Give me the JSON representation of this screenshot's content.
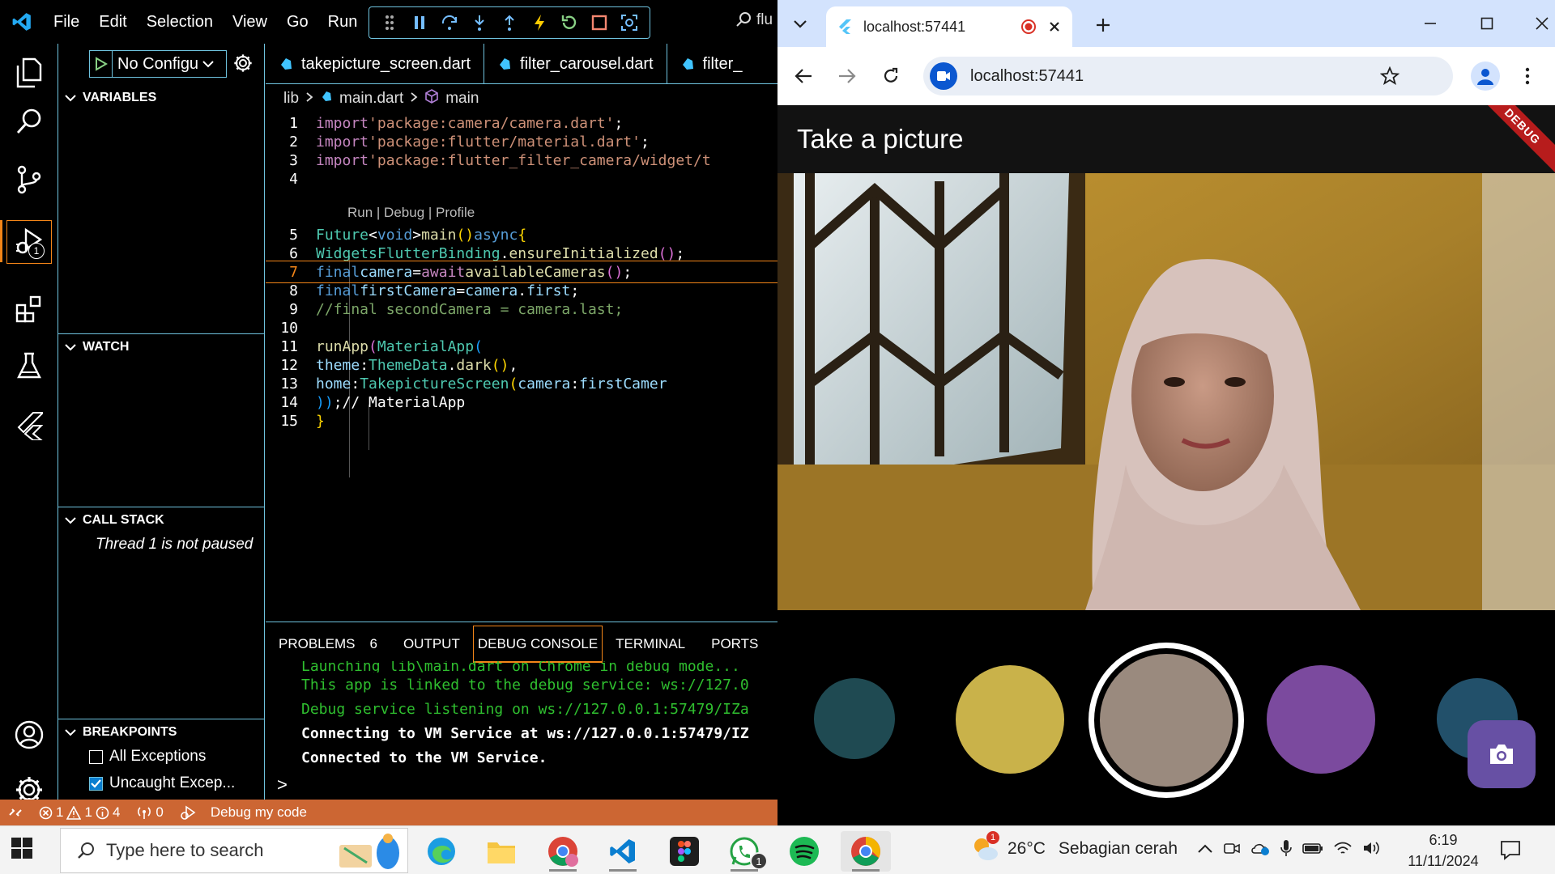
{
  "vscode": {
    "menu": [
      "File",
      "Edit",
      "Selection",
      "View",
      "Go",
      "Run"
    ],
    "title_search": "flu",
    "run_config": "No Configu",
    "sections": {
      "variables": "VARIABLES",
      "watch": "WATCH",
      "call_stack": "CALL STACK",
      "breakpoints": "BREAKPOINTS"
    },
    "thread_status": "Thread 1 is not paused",
    "breakpoints": [
      {
        "label": "All Exceptions",
        "checked": false
      },
      {
        "label": "Uncaught Excep...",
        "checked": true
      }
    ],
    "tabs": [
      "takepicture_screen.dart",
      "filter_carousel.dart",
      "filter_"
    ],
    "breadcrumb": [
      "lib",
      "main.dart",
      "main"
    ],
    "codelens": "Run | Debug | Profile",
    "line_numbers": [
      "1",
      "2",
      "3",
      "4",
      "5",
      "6",
      "7",
      "8",
      "9",
      "10",
      "11",
      "12",
      "13",
      "14",
      "15"
    ],
    "code": {
      "l1_kw": "import",
      "l1_str": "'package:camera/camera.dart'",
      "l1_end": ";",
      "l2_kw": "import",
      "l2_str": "'package:flutter/material.dart'",
      "l2_end": ";",
      "l3_kw": "import",
      "l3_str": "'package:flutter_filter_camera/widget/t",
      "l5_type": "Future",
      "l5_lt": "<",
      "l5_void": "void",
      "l5_gt": ">",
      "l5_fn": "main",
      "l5_paren": "()",
      "l5_async": "async",
      "l5_brace": "{",
      "l6_cls": "WidgetsFlutterBinding",
      "l6_dot": ".",
      "l6_fn": "ensureInitialized",
      "l6_paren": "()",
      "l6_end": ";",
      "l7_kw": "final",
      "l7_var": "camera",
      "l7_eq": "=",
      "l7_await": "await",
      "l7_fn": "availableCameras",
      "l7_paren": "()",
      "l7_end": ";",
      "l8_kw": "final",
      "l8_var": "firstCamera",
      "l8_eq": "=",
      "l8_obj": "camera",
      "l8_dot": ".",
      "l8_prop": "first",
      "l8_end": ";",
      "l9_comment": "//final secondCamera = camera.last;",
      "l11_fn": "runApp",
      "l11_p": "(",
      "l11_cls": "MaterialApp",
      "l11_p2": "(",
      "l12_prop": "theme",
      "l12_colon": ":",
      "l12_cls": "ThemeData",
      "l12_dot": ".",
      "l12_fn": "dark",
      "l12_paren": "()",
      "l12_comma": ",",
      "l13_prop": "home",
      "l13_colon": ":",
      "l13_cls": "TakepictureScreen",
      "l13_p": "(",
      "l13_arg": "camera",
      "l13_colon2": ":",
      "l13_val": "firstCamer",
      "l14_close": "))",
      "l14_end": ";",
      "l14_comment": "// MaterialApp",
      "l15_brace": "}"
    },
    "panel_tabs": [
      {
        "label": "PROBLEMS",
        "count": "6"
      },
      {
        "label": "OUTPUT"
      },
      {
        "label": "DEBUG CONSOLE"
      },
      {
        "label": "TERMINAL"
      },
      {
        "label": "PORTS"
      }
    ],
    "console_lines": [
      "Launching lib\\main.dart on Chrome in debug mode...",
      "This app is linked to the debug service: ws://127.0",
      "Debug service listening on ws://127.0.0.1:57479/IZa",
      "Connecting to VM Service at ws://127.0.0.1:57479/IZ",
      "Connected to the VM Service."
    ],
    "console_prompt": ">",
    "status": {
      "errors": "1",
      "warnings": "1",
      "infos": "4",
      "ports": "0",
      "debug_label": "Debug my code"
    },
    "activity_badge": "1",
    "colors": {
      "accent": "#f38518",
      "border": "#6fc3df",
      "statusbar": "#cc6633"
    }
  },
  "browser": {
    "tab_title": "localhost:57441",
    "url": "localhost:57441",
    "app_title": "Take a picture",
    "debug_banner": "DEBUG",
    "filters": [
      {
        "color": "#1f4a52",
        "selected": false
      },
      {
        "color": "#c9b24a",
        "selected": false
      },
      {
        "color": "#9a8a7e",
        "selected": true
      },
      {
        "color": "#7b4a9e",
        "selected": false
      },
      {
        "color": "#22506a",
        "selected": false
      }
    ]
  },
  "taskbar": {
    "search_placeholder": "Type here to search",
    "weather_temp": "26°C",
    "weather_text": "Sebagian cerah",
    "weather_badge": "1",
    "whatsapp_badge": "1",
    "time": "6:19",
    "date": "11/11/2024"
  }
}
